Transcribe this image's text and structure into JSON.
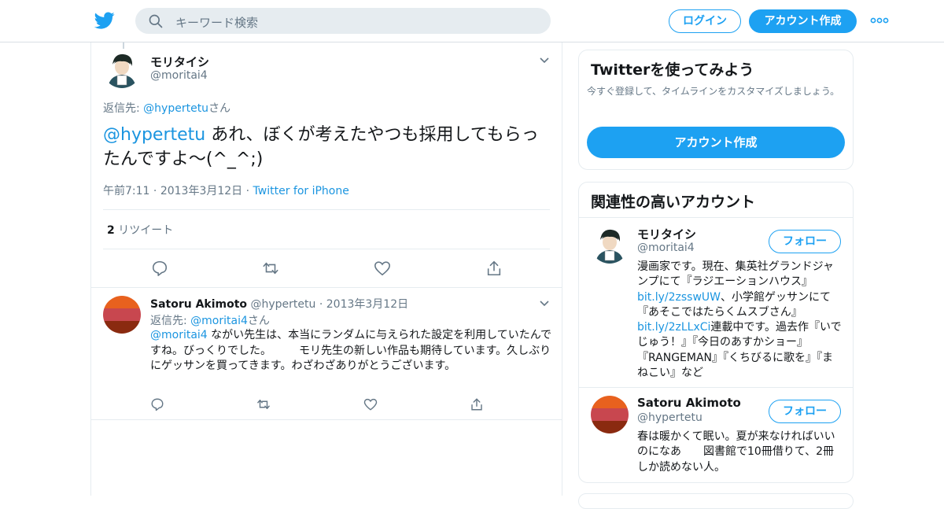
{
  "topbar": {
    "logo_icon": "twitter-bird-icon",
    "search_placeholder": "キーワード検索",
    "login_label": "ログイン",
    "signup_label": "アカウント作成",
    "more_icon": "more-dots-icon",
    "accent_color": "#1da1f2"
  },
  "main_tweet": {
    "name": "モリタイシ",
    "handle": "@moritai4",
    "reply_prefix": "返信先: ",
    "reply_to": "@hypertetu",
    "reply_suffix": "さん",
    "mention": "@hypertetu",
    "text": " あれ、ぼくが考えたやつも採用してもらったんですよ〜(^_^;)",
    "time": "午前7:11",
    "date": "2013年3月12日",
    "sep": " · ",
    "source": "Twitter for iPhone",
    "retweet_count": "2",
    "retweet_label": " リツイート",
    "actions": [
      "reply-icon",
      "retweet-icon",
      "like-icon",
      "share-icon"
    ]
  },
  "reply_tweet": {
    "name": "Satoru Akimoto",
    "handle": "@hypertetu",
    "sep": " · ",
    "date": "2013年3月12日",
    "reply_prefix": "返信先: ",
    "reply_to": "@moritai4",
    "reply_suffix": "さん",
    "mention": "@moritai4",
    "text": " ながい先生は、本当にランダムに与えられた設定を利用していたんですね。びっくりでした。　　　モリ先生の新しい作品も期待しています。久しぶりにゲッサンを買ってきます。わざわざありがとうございます。",
    "actions": [
      "reply-icon",
      "retweet-icon",
      "like-icon",
      "share-icon"
    ]
  },
  "sidebar": {
    "try_card": {
      "title": "Twitterを使ってみよう",
      "description": "今すぐ登録して、タイムラインをカスタマイズしましょう。",
      "button_label": "アカウント作成"
    },
    "related": {
      "title": "関連性の高いアカウント",
      "accounts": [
        {
          "name": "モリタイシ",
          "handle": "@moritai4",
          "follow_label": "フォロー",
          "bio_1": "漫画家です。現在、集英社グランドジャンプにて『ラジエーションハウス』",
          "bio_link_1": "bit.ly/2zsswUW",
          "bio_2": "、小学館ゲッサンにて『あそこではたらくムスブさん』",
          "bio_link_2": "bit.ly/2zLLxCi",
          "bio_3": "連載中です。過去作『いでじゅう！』『今日のあすかショー』『RANGEMAN』『くちびるに歌を』『まねこい』など"
        },
        {
          "name": "Satoru Akimoto",
          "handle": "@hypertetu",
          "follow_label": "フォロー",
          "bio": "春は暖かくて眠い。夏が来なければいいのになあ　　図書館で10冊借りて、2冊しか読めない人。"
        }
      ]
    }
  }
}
